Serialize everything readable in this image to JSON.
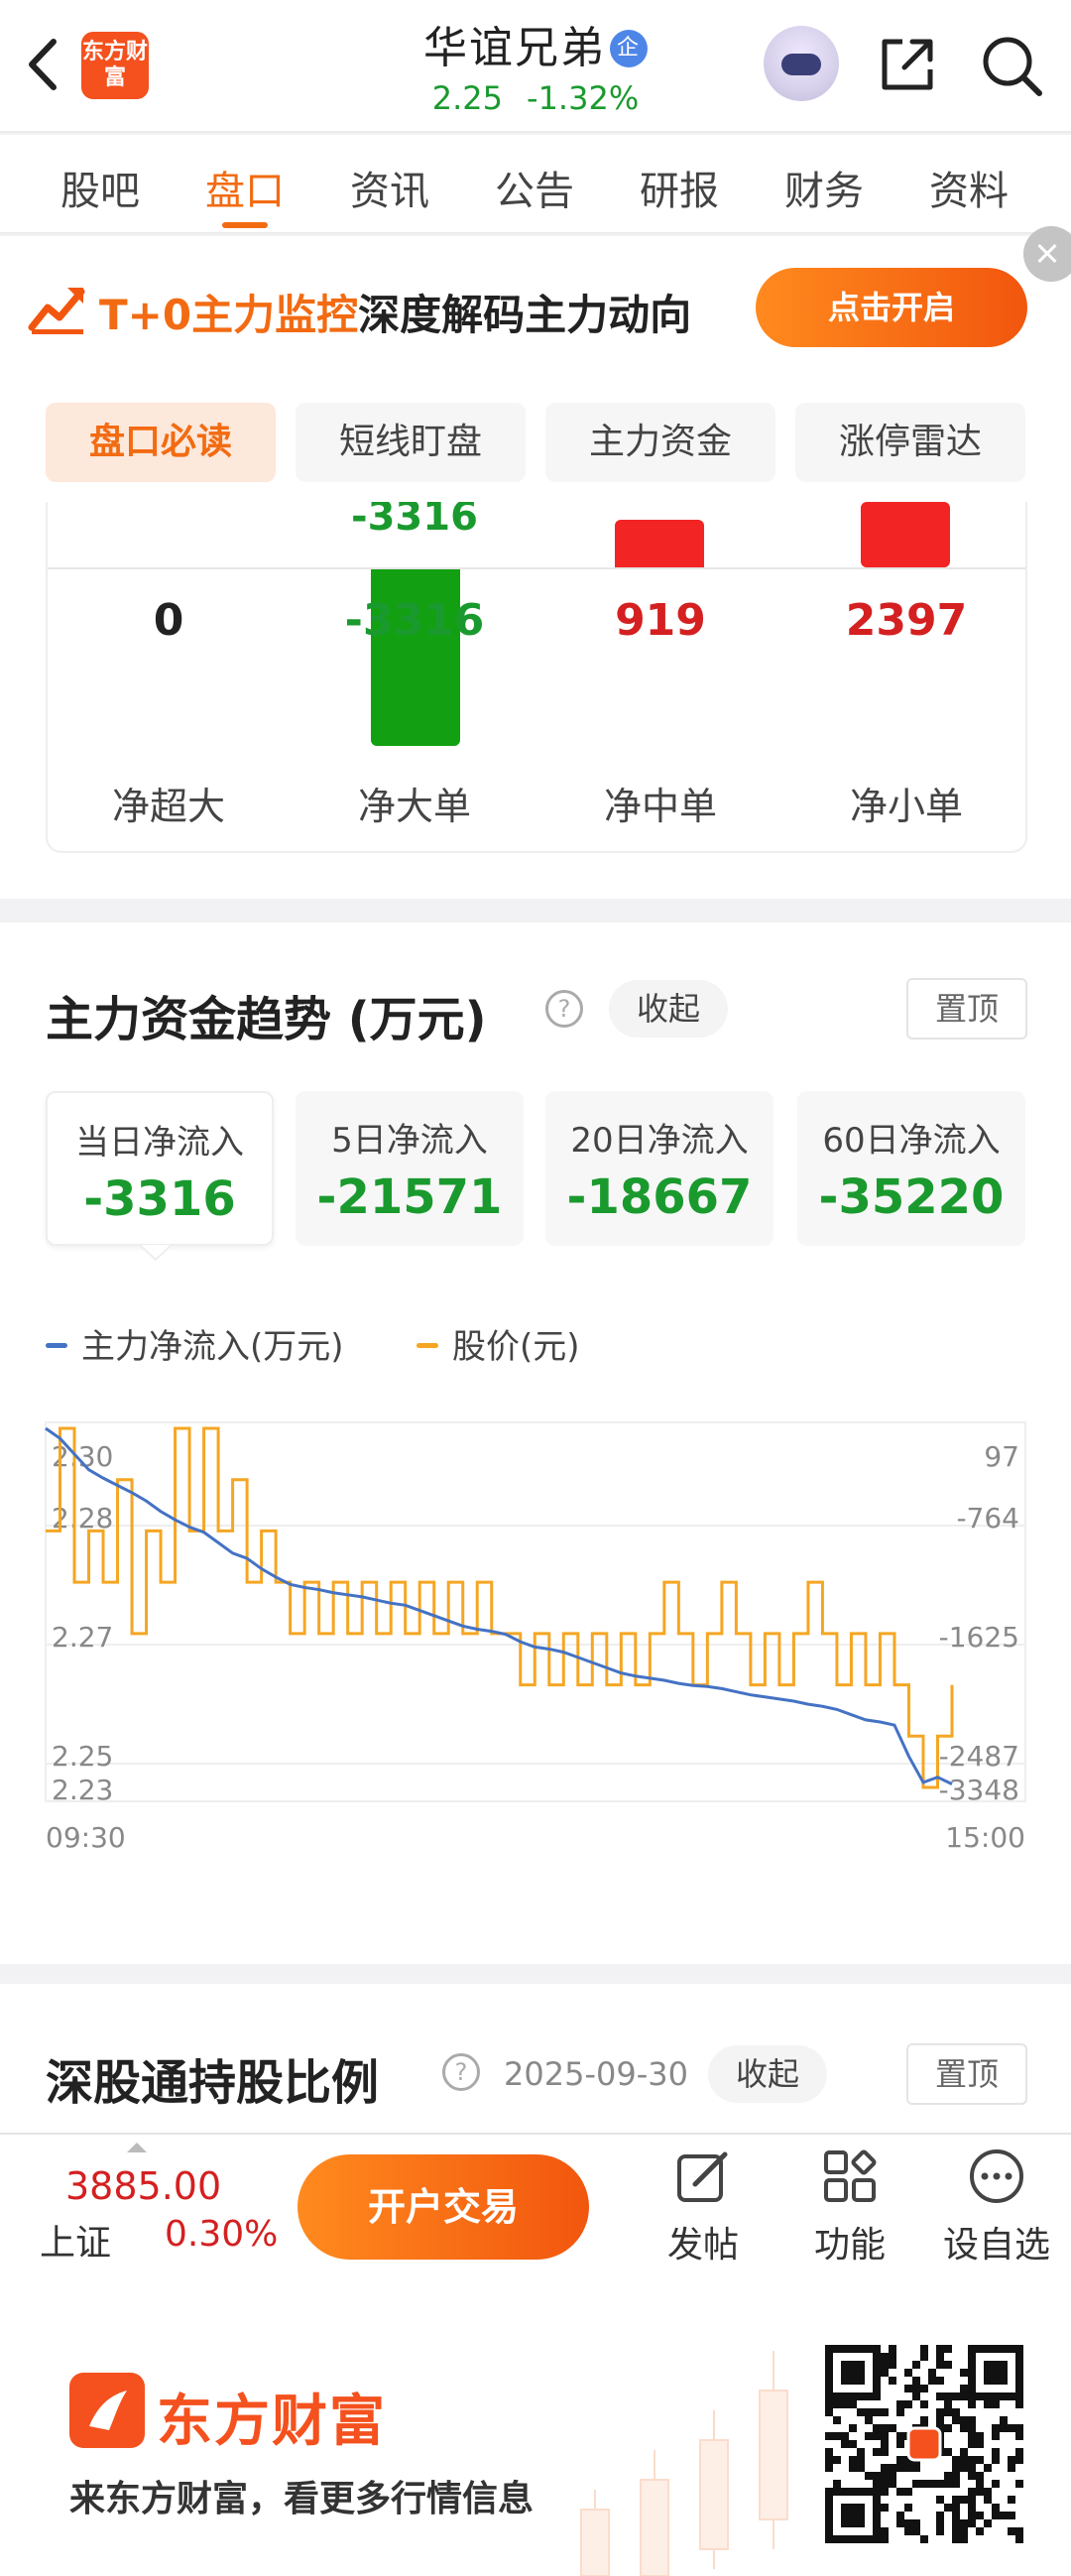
{
  "header": {
    "app_logo_text": "东方财富",
    "stock_name": "华谊兄弟",
    "enterprise_badge": "企",
    "price": "2.25",
    "change_pct": "-1.32%"
  },
  "tabs": [
    "股吧",
    "盘口",
    "资讯",
    "公告",
    "研报",
    "财务",
    "资料"
  ],
  "active_tab": "盘口",
  "banner": {
    "text_highlight": "T+0主力监控",
    "text_rest": "深度解码主力动向",
    "button": "点击开启"
  },
  "subtabs": [
    "盘口必读",
    "短线盯盘",
    "主力资金",
    "涨停雷达"
  ],
  "flow": {
    "top_label": "-3316",
    "items": [
      {
        "label": "净超大",
        "value": "0",
        "color": "#222222"
      },
      {
        "label": "净大单",
        "value": "-3316",
        "color": "#1a9a2e"
      },
      {
        "label": "净中单",
        "value": "919",
        "color": "#d42020"
      },
      {
        "label": "净小单",
        "value": "2397",
        "color": "#d42020"
      }
    ]
  },
  "trend": {
    "title": "主力资金趋势 (万元)",
    "collapse": "收起",
    "pin": "置顶",
    "stats": [
      {
        "label": "当日净流入",
        "value": "-3316"
      },
      {
        "label": "5日净流入",
        "value": "-21571"
      },
      {
        "label": "20日净流入",
        "value": "-18667"
      },
      {
        "label": "60日净流入",
        "value": "-35220"
      }
    ]
  },
  "chart_data": {
    "type": "line",
    "legend": [
      "主力净流入(万元)",
      "股价(元)"
    ],
    "x_start": "09:30",
    "x_end": "15:00",
    "left_axis_ticks": [
      "2.30",
      "2.28",
      "2.27",
      "2.25",
      "2.23"
    ],
    "right_axis_ticks": [
      "97",
      "-764",
      "-1625",
      "-2487",
      "-3348"
    ],
    "colors": {
      "net_inflow": "#4472c4",
      "price": "#f5a623"
    },
    "series": [
      {
        "name": "主力净流入(万元)",
        "axis": "right",
        "values": [
          97,
          0,
          -150,
          -300,
          -380,
          -450,
          -520,
          -600,
          -700,
          -780,
          -850,
          -900,
          -1000,
          -1100,
          -1150,
          -1250,
          -1330,
          -1400,
          -1430,
          -1450,
          -1480,
          -1500,
          -1520,
          -1550,
          -1580,
          -1600,
          -1650,
          -1700,
          -1750,
          -1800,
          -1830,
          -1850,
          -1880,
          -1950,
          -2000,
          -2020,
          -2050,
          -2100,
          -2150,
          -2200,
          -2250,
          -2280,
          -2300,
          -2320,
          -2350,
          -2370,
          -2380,
          -2400,
          -2430,
          -2460,
          -2480,
          -2500,
          -2520,
          -2550,
          -2570,
          -2600,
          -2650,
          -2700,
          -2720,
          -2750,
          -3050,
          -3300,
          -3250,
          -3316
        ]
      },
      {
        "name": "股价(元)",
        "axis": "left",
        "values": [
          2.28,
          2.3,
          2.27,
          2.28,
          2.27,
          2.29,
          2.26,
          2.28,
          2.27,
          2.3,
          2.28,
          2.3,
          2.28,
          2.29,
          2.27,
          2.28,
          2.27,
          2.26,
          2.27,
          2.26,
          2.27,
          2.26,
          2.27,
          2.26,
          2.27,
          2.26,
          2.27,
          2.26,
          2.27,
          2.26,
          2.27,
          2.26,
          2.26,
          2.25,
          2.26,
          2.25,
          2.26,
          2.25,
          2.26,
          2.25,
          2.26,
          2.25,
          2.26,
          2.27,
          2.26,
          2.25,
          2.26,
          2.27,
          2.26,
          2.25,
          2.26,
          2.25,
          2.26,
          2.27,
          2.26,
          2.25,
          2.26,
          2.25,
          2.26,
          2.25,
          2.24,
          2.23,
          2.24,
          2.25
        ]
      }
    ]
  },
  "hk_hold": {
    "title": "深股通持股比例",
    "date": "2025-09-30",
    "collapse": "收起",
    "pin": "置顶"
  },
  "bottom_bar": {
    "index_value": "3885.00",
    "index_name": "上证",
    "index_pct": "0.30%",
    "trade_button": "开户交易",
    "actions": [
      "发帖",
      "功能",
      "设自选"
    ]
  },
  "footer": {
    "brand": "东方财富",
    "slogan": "来东方财富，看更多行情信息"
  }
}
